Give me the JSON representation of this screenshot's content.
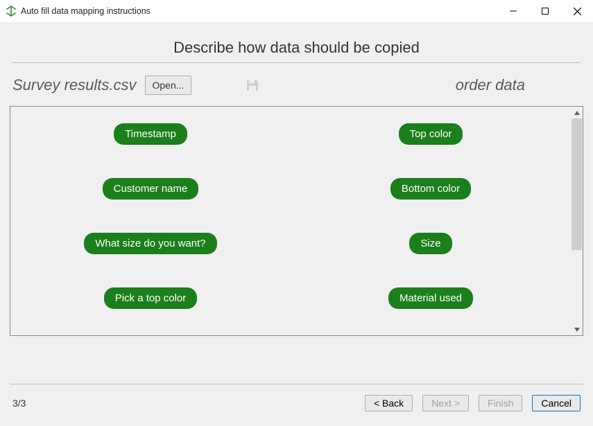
{
  "window": {
    "title": "Auto fill data mapping instructions"
  },
  "heading": "Describe how data should be copied",
  "source": {
    "filename": "Survey results.csv",
    "open_label": "Open..."
  },
  "target": {
    "label": "order data"
  },
  "mappings": [
    {
      "left": "Timestamp",
      "right": "Top color"
    },
    {
      "left": "Customer name",
      "right": "Bottom color"
    },
    {
      "left": "What size do you want?",
      "right": "Size"
    },
    {
      "left": "Pick a top color",
      "right": "Material used"
    }
  ],
  "footer": {
    "page": "3/3",
    "back": "< Back",
    "next": "Next >",
    "finish": "Finish",
    "cancel": "Cancel"
  }
}
